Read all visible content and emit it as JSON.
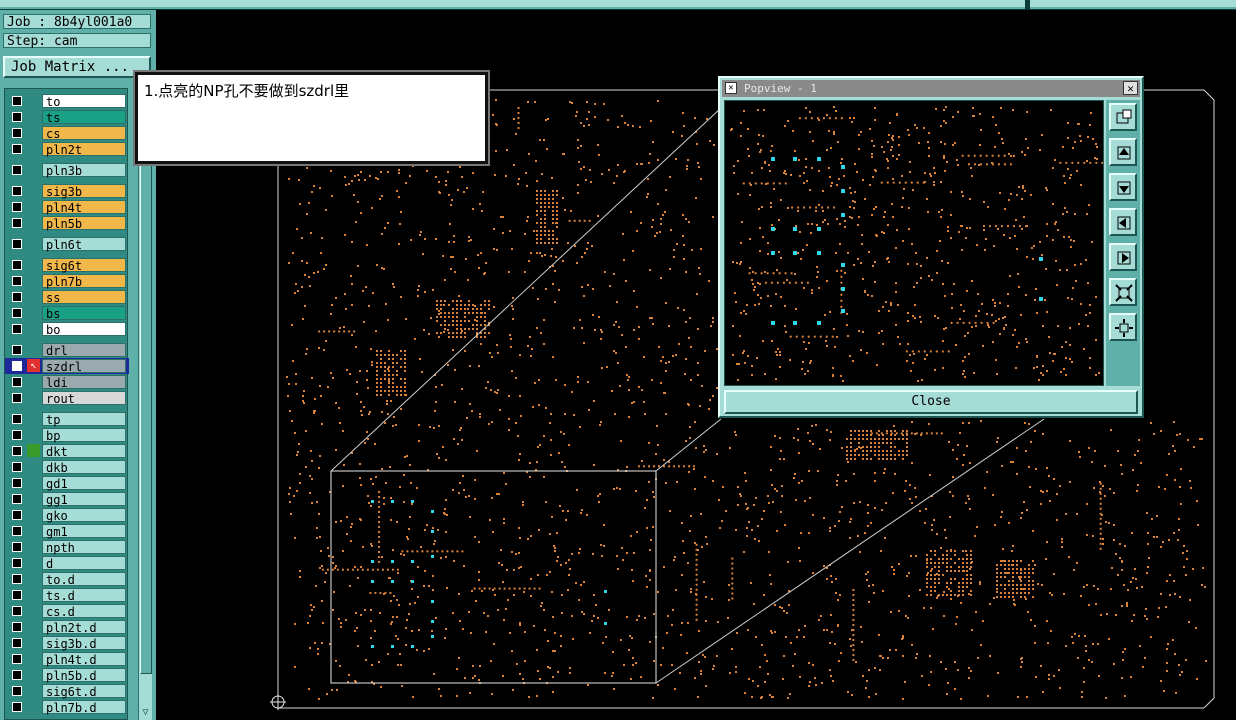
{
  "job": {
    "job_label": "Job : 8b4yl001a0",
    "step_label": "Step: cam",
    "matrix_button": "Job Matrix ..."
  },
  "colors": {
    "panel_bg": "#5fb0a8",
    "panel_light": "#a6dcd6",
    "layer_white": "#ffffff",
    "layer_green": "#1aa085",
    "layer_orange": "#f0b84a",
    "layer_teal": "#a6dcd6",
    "layer_grey": "#9aa9ad",
    "drill_copper": "#d8823a",
    "highlight_np": "#2fd8e8"
  },
  "layers": [
    {
      "name": "to",
      "color": "#ffffff",
      "extra": ""
    },
    {
      "name": "ts",
      "color": "#1aa085",
      "extra": ""
    },
    {
      "name": "cs",
      "color": "#f0b84a",
      "extra": ""
    },
    {
      "name": "pln2t",
      "color": "#f0b84a",
      "extra": ""
    },
    {
      "name": "pln3b",
      "color": "#a6dcd6",
      "extra": ""
    },
    {
      "name": "sig3b",
      "color": "#f0b84a",
      "extra": ""
    },
    {
      "name": "pln4t",
      "color": "#f0b84a",
      "extra": ""
    },
    {
      "name": "pln5b",
      "color": "#f0b84a",
      "extra": ""
    },
    {
      "name": "pln6t",
      "color": "#a6dcd6",
      "extra": ""
    },
    {
      "name": "sig6t",
      "color": "#f0b84a",
      "extra": ""
    },
    {
      "name": "pln7b",
      "color": "#f0b84a",
      "extra": ""
    },
    {
      "name": "ss",
      "color": "#f0b84a",
      "extra": ""
    },
    {
      "name": "bs",
      "color": "#1aa085",
      "extra": ""
    },
    {
      "name": "bo",
      "color": "#ffffff",
      "extra": ""
    },
    {
      "name": "drl",
      "color": "#9aa9ad",
      "extra": ""
    },
    {
      "name": "szdrl",
      "color": "#9aa9ad",
      "extra": "work"
    },
    {
      "name": "ldi",
      "color": "#9aa9ad",
      "extra": ""
    },
    {
      "name": "rout",
      "color": "#d8d8d8",
      "extra": ""
    },
    {
      "name": "tp",
      "color": "#a6dcd6",
      "extra": ""
    },
    {
      "name": "bp",
      "color": "#a6dcd6",
      "extra": ""
    },
    {
      "name": "dkt",
      "color": "#a6dcd6",
      "extra": "affected"
    },
    {
      "name": "dkb",
      "color": "#a6dcd6",
      "extra": ""
    },
    {
      "name": "gd1",
      "color": "#a6dcd6",
      "extra": ""
    },
    {
      "name": "gg1",
      "color": "#a6dcd6",
      "extra": ""
    },
    {
      "name": "gko",
      "color": "#a6dcd6",
      "extra": ""
    },
    {
      "name": "gm1",
      "color": "#a6dcd6",
      "extra": ""
    },
    {
      "name": "npth",
      "color": "#a6dcd6",
      "extra": ""
    },
    {
      "name": "d",
      "color": "#a6dcd6",
      "extra": ""
    },
    {
      "name": "to.d",
      "color": "#a6dcd6",
      "extra": ""
    },
    {
      "name": "ts.d",
      "color": "#a6dcd6",
      "extra": ""
    },
    {
      "name": "cs.d",
      "color": "#a6dcd6",
      "extra": ""
    },
    {
      "name": "pln2t.d",
      "color": "#a6dcd6",
      "extra": ""
    },
    {
      "name": "sig3b.d",
      "color": "#a6dcd6",
      "extra": ""
    },
    {
      "name": "pln4t.d",
      "color": "#a6dcd6",
      "extra": ""
    },
    {
      "name": "pln5b.d",
      "color": "#a6dcd6",
      "extra": ""
    },
    {
      "name": "sig6t.d",
      "color": "#a6dcd6",
      "extra": ""
    },
    {
      "name": "pln7b.d",
      "color": "#a6dcd6",
      "extra": ""
    }
  ],
  "note": {
    "text": "1.点亮的NP孔不要做到szdrl里"
  },
  "popview": {
    "title": "Popview - 1",
    "close_label": "Close",
    "tools": [
      "zoom-fit-icon",
      "pan-up-icon",
      "pan-down-icon",
      "pan-left-icon",
      "pan-right-icon",
      "zoom-out-icon",
      "zoom-in-icon"
    ]
  }
}
